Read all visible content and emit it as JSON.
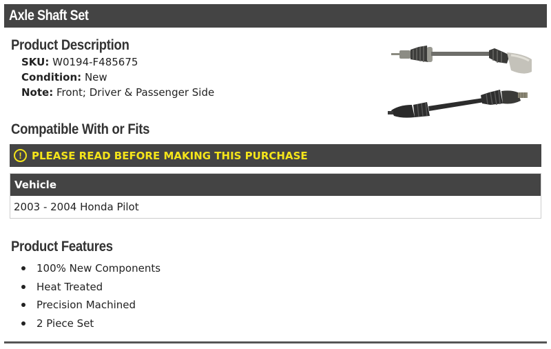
{
  "header": {
    "title": "Axle Shaft Set"
  },
  "description": {
    "heading": "Product Description",
    "sku_label": "SKU:",
    "sku_value": "W0194-F485675",
    "condition_label": "Condition:",
    "condition_value": "New",
    "note_label": "Note:",
    "note_value": "Front; Driver & Passenger Side"
  },
  "compatibility": {
    "heading": "Compatible With or Fits",
    "warning_icon": "!",
    "warning_text": "PLEASE READ BEFORE MAKING THIS PURCHASE",
    "table_header": "Vehicle",
    "rows": [
      "2003 - 2004 Honda Pilot"
    ]
  },
  "features": {
    "heading": "Product Features",
    "items": [
      "100% New Components",
      "Heat Treated",
      "Precision Machined",
      "2 Piece Set"
    ]
  },
  "colors": {
    "bar": "#444444",
    "warning": "#f5e51a"
  }
}
